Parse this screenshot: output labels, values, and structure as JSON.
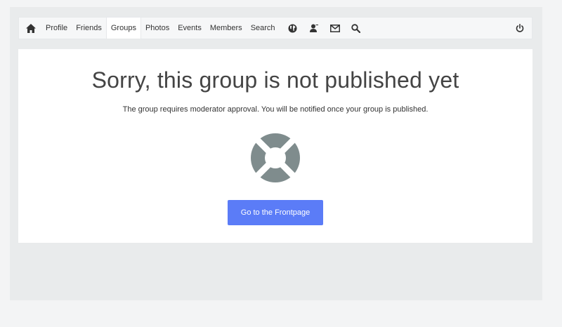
{
  "nav": {
    "items": [
      {
        "label": "Profile"
      },
      {
        "label": "Friends"
      },
      {
        "label": "Groups"
      },
      {
        "label": "Photos"
      },
      {
        "label": "Events"
      },
      {
        "label": "Members"
      },
      {
        "label": "Search"
      }
    ],
    "active_item": "Groups",
    "icons": [
      "home-icon",
      "globe-icon",
      "friend-request-icon",
      "mail-icon",
      "search-icon",
      "power-icon"
    ]
  },
  "message": {
    "title": "Sorry, this group is not published yet",
    "body": "The group requires moderator approval. You will be notified once your group is published.",
    "icon": "lifebuoy-icon",
    "button_label": "Go to the Frontpage"
  },
  "colors": {
    "accent": "#5b7cf7",
    "icon_gray": "#7f8c8d"
  }
}
